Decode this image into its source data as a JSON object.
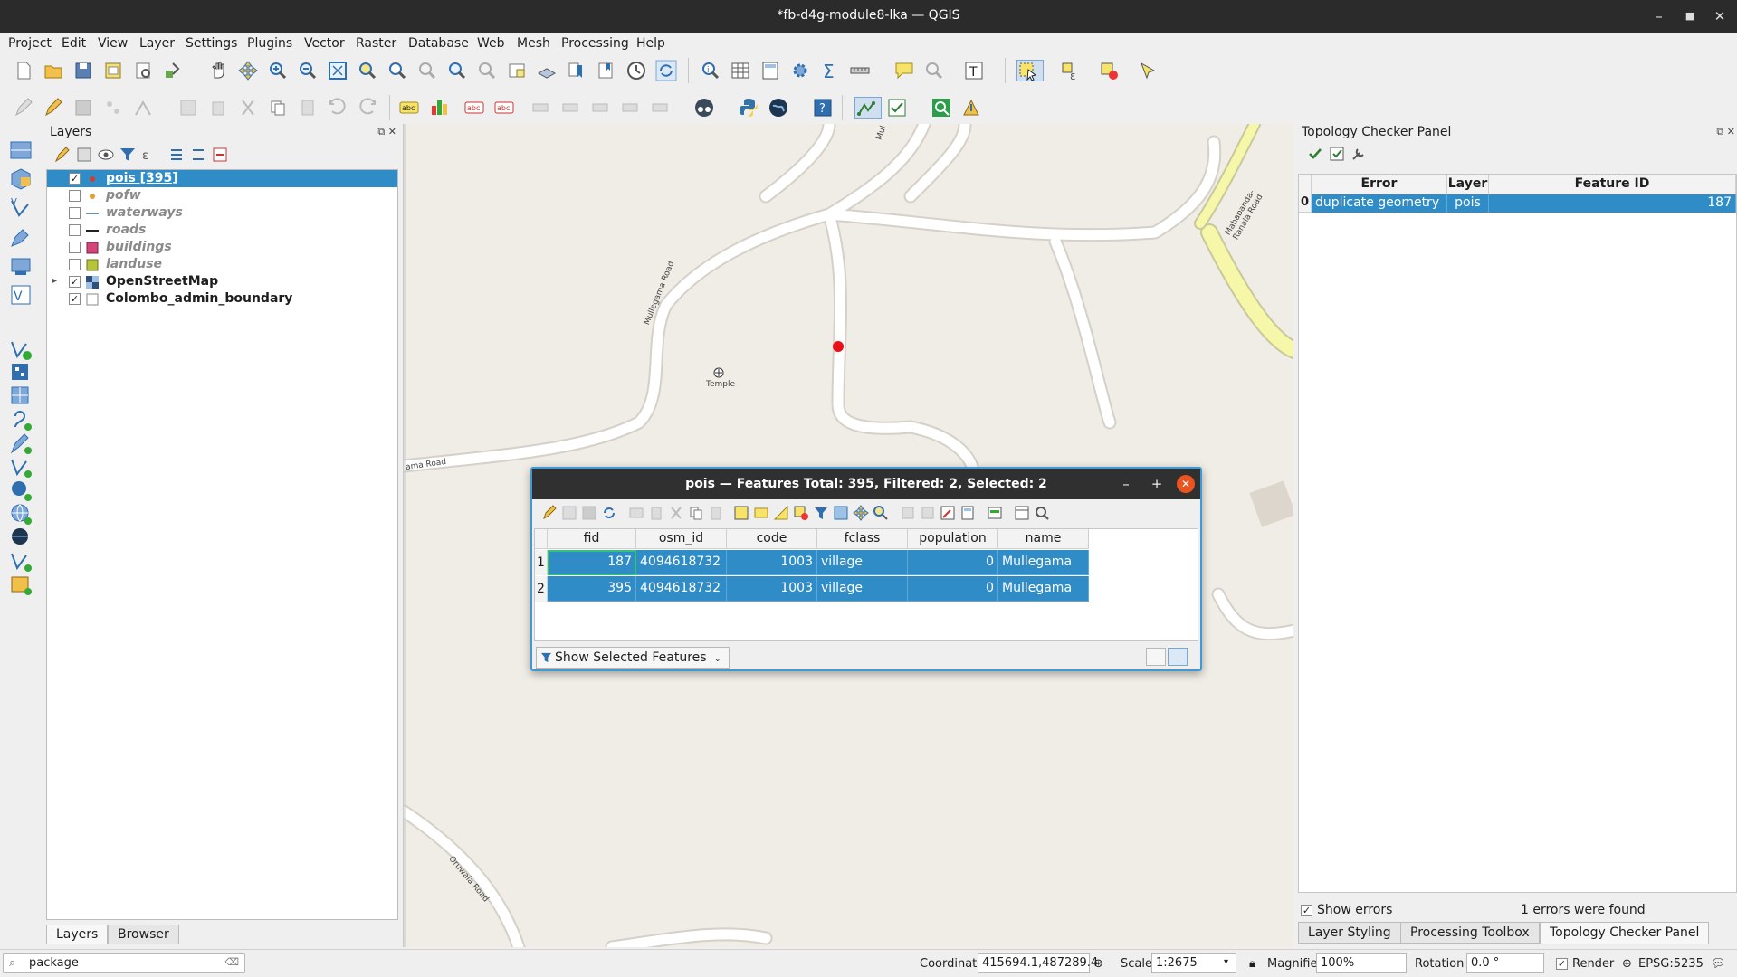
{
  "window": {
    "title": "*fb-d4g-module8-lka — QGIS"
  },
  "menu": [
    "Project",
    "Edit",
    "View",
    "Layer",
    "Settings",
    "Plugins",
    "Vector",
    "Raster",
    "Database",
    "Web",
    "Mesh",
    "Processing",
    "Help"
  ],
  "layers_panel": {
    "title": "Layers",
    "layers": [
      {
        "name": "pois [395]",
        "checked": true,
        "selected": true,
        "symbol": "point-red"
      },
      {
        "name": "pofw",
        "checked": false,
        "symbol": "point-orange"
      },
      {
        "name": "waterways",
        "checked": false,
        "symbol": "line-blue"
      },
      {
        "name": "roads",
        "checked": false,
        "symbol": "line-black"
      },
      {
        "name": "buildings",
        "checked": false,
        "symbol": "fill-pink"
      },
      {
        "name": "landuse",
        "checked": false,
        "symbol": "fill-olive"
      },
      {
        "name": "OpenStreetMap",
        "checked": true,
        "symbol": "raster"
      },
      {
        "name": "Colombo_admin_boundary",
        "checked": true,
        "symbol": "fill-empty"
      }
    ],
    "tabs": [
      "Layers",
      "Browser"
    ]
  },
  "map": {
    "labels": {
      "temple": "Temple",
      "mullegama_road": "Mullegama Road",
      "road_left": "ama Road",
      "mahabanda": "Mahabanda-Ranala Road",
      "oruwala": "Oruwala Road",
      "top_road": "Mul"
    },
    "colors": {
      "road": "#ffffff",
      "road_casing": "#d5d0c8",
      "main_road": "#f6f7a9",
      "background": "#f0ede6",
      "selected_point": "#e8101a"
    }
  },
  "attribute_table": {
    "title": "pois — Features Total: 395, Filtered: 2, Selected: 2",
    "columns": [
      "fid",
      "osm_id",
      "code",
      "fclass",
      "population",
      "name"
    ],
    "rows": [
      {
        "num": "1",
        "fid": "187",
        "osm_id": "4094618732",
        "code": "1003",
        "fclass": "village",
        "population": "0",
        "name": "Mullegama"
      },
      {
        "num": "2",
        "fid": "395",
        "osm_id": "4094618732",
        "code": "1003",
        "fclass": "village",
        "population": "0",
        "name": "Mullegama"
      }
    ],
    "filter_button": "Show Selected Features"
  },
  "topology_panel": {
    "title": "Topology Checker Panel",
    "columns": [
      "Error",
      "Layer",
      "Feature ID"
    ],
    "rows": [
      {
        "num": "0",
        "error": "duplicate geometry",
        "layer": "pois",
        "feature_id": "187"
      }
    ],
    "show_errors_label": "Show errors",
    "show_errors_checked": true,
    "status": "1 errors were found",
    "tabs": [
      "Layer Styling",
      "Processing Toolbox",
      "Topology Checker Panel"
    ]
  },
  "statusbar": {
    "search_value": "package",
    "coordinate_label": "Coordinate",
    "coordinate_value": "415694.1,487289.4",
    "scale_label": "Scale",
    "scale_value": "1:2675",
    "magnifier_label": "Magnifier",
    "magnifier_value": "100%",
    "rotation_label": "Rotation",
    "rotation_value": "0.0 °",
    "render_label": "Render",
    "crs": "EPSG:5235"
  }
}
